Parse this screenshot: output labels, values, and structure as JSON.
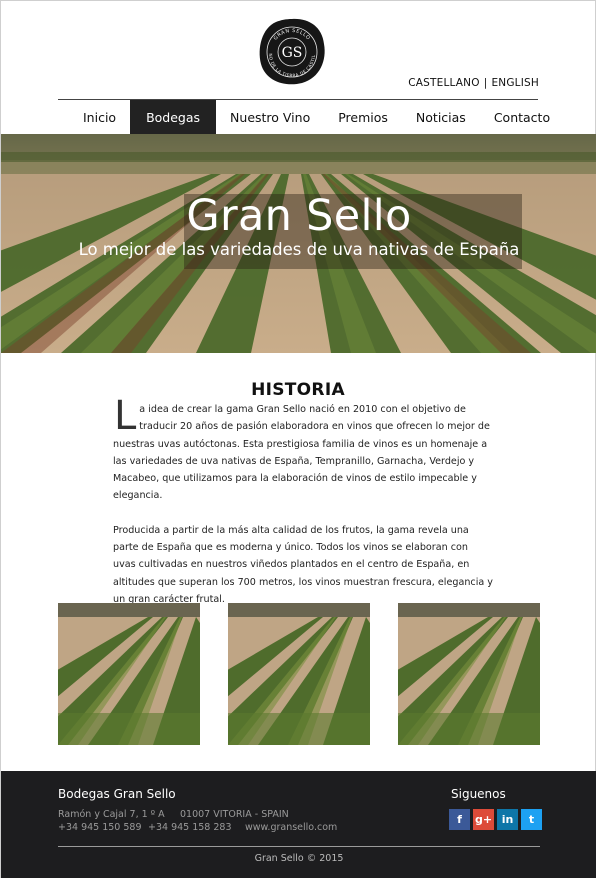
{
  "brand": {
    "logo_text_top": "GRAN SELLO",
    "logo_text_ring": "VINO DE LA TIERRA DE CASTILLA",
    "logo_monogram": "GS"
  },
  "lang": {
    "es": "CASTELLANO",
    "sep": "|",
    "en": "ENGLISH"
  },
  "nav": {
    "items": [
      {
        "label": "Inicio",
        "active": false
      },
      {
        "label": "Bodegas",
        "active": true
      },
      {
        "label": "Nuestro Vino",
        "active": false
      },
      {
        "label": "Premios",
        "active": false
      },
      {
        "label": "Noticias",
        "active": false
      },
      {
        "label": "Contacto",
        "active": false
      }
    ]
  },
  "hero": {
    "title": "Gran Sello",
    "subtitle": "Lo mejor de las variedades de uva nativas de España"
  },
  "history": {
    "title": "HISTORIA",
    "dropcap": "L",
    "p1_rest": "a idea de crear la gama Gran Sello nació en 2010 con el objetivo de traducir 20 años de pasión elaboradora en vinos que ofrecen lo mejor de nuestras uvas autóctonas. Esta prestigiosa familia de vinos es un homenaje a las variedades de uva nativas de España, Tempranillo, Garnacha, Verdejo y Macabeo, que utilizamos para la elaboración de vinos de estilo impecable y elegancia.",
    "p2": "Producida a partir de la más alta calidad de los frutos, la gama revela una parte de España que es moderna y único. Todos los vinos se elaboran con uvas cultivadas en nuestros viñedos plantados en el centro de España, en altitudes que superan los 700 metros, los vinos muestran frescura, elegancia y un gran carácter frutal."
  },
  "footer": {
    "company": "Bodegas Gran Sello",
    "address": "Ramón y Cajal 7, 1 º A",
    "city": "01007 VITORIA - SPAIN",
    "phone1": "+34 945 150 589",
    "phone2": "+34 945 158 283",
    "web": "www.gransello.com",
    "follow": "Siguenos",
    "social": [
      {
        "icon": "facebook-icon",
        "glyph": "f",
        "color": "#3b5998"
      },
      {
        "icon": "google-plus-icon",
        "glyph": "g+",
        "color": "#dd4b39"
      },
      {
        "icon": "linkedin-icon",
        "glyph": "in",
        "color": "#0e76a8"
      },
      {
        "icon": "twitter-icon",
        "glyph": "t",
        "color": "#1da1f2"
      }
    ],
    "copyright": "Gran Sello © 2015"
  },
  "colors": {
    "nav_active_bg": "#222222",
    "footer_bg": "#1d1d1f",
    "hero_band": "rgba(40,30,20,0.42)"
  }
}
